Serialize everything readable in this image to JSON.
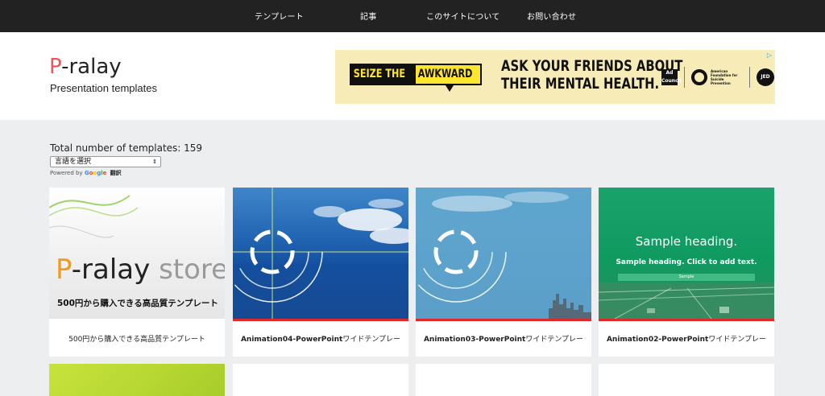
{
  "nav": {
    "items": [
      "テンプレート",
      "記事",
      "このサイトについて",
      "お問い合わせ"
    ]
  },
  "header": {
    "logo_p": "P",
    "logo_rest": "-ralay",
    "tagline": "Presentation templates"
  },
  "ad": {
    "info_icon": "▷",
    "seize_left": "SEIZE THE",
    "seize_right": "AWKWARD",
    "headline_line1": "ASK YOUR FRIENDS ABOUT",
    "headline_line2": "THEIR MENTAL HEALTH.",
    "adcouncil": "Ad Council",
    "afsp": "American Foundation for Suicide Prevention",
    "jed": "JED"
  },
  "content": {
    "total_label": "Total number of templates: 159",
    "language_select": "言語を選択",
    "powered_by": "Powered by",
    "google": "Google",
    "translate": "翻訳"
  },
  "cards": [
    {
      "title": "500円から購入できる高品質テンプレート",
      "thumb_logo_p": "P",
      "thumb_logo_rest": "-ralay",
      "thumb_store": "store",
      "thumb_caption": "500円から購入できる高品質テンプレート"
    },
    {
      "title_bold": "Animation04-PowerPoint",
      "title_rest": "ワイドテンプレー"
    },
    {
      "title_bold": "Animation03-PowerPoint",
      "title_rest": "ワイドテンプレー"
    },
    {
      "title_bold": "Animation02-PowerPoint",
      "title_rest": "ワイドテンプレー",
      "thumb_heading": "Sample heading.",
      "thumb_sub": "Sample heading. Click to add text.",
      "thumb_small": "Sample"
    }
  ],
  "colors": {
    "nav_bg": "#222222",
    "logo_accent": "#f0525e",
    "card_bar": "#e02a2a",
    "page_bg": "#eceef0"
  }
}
